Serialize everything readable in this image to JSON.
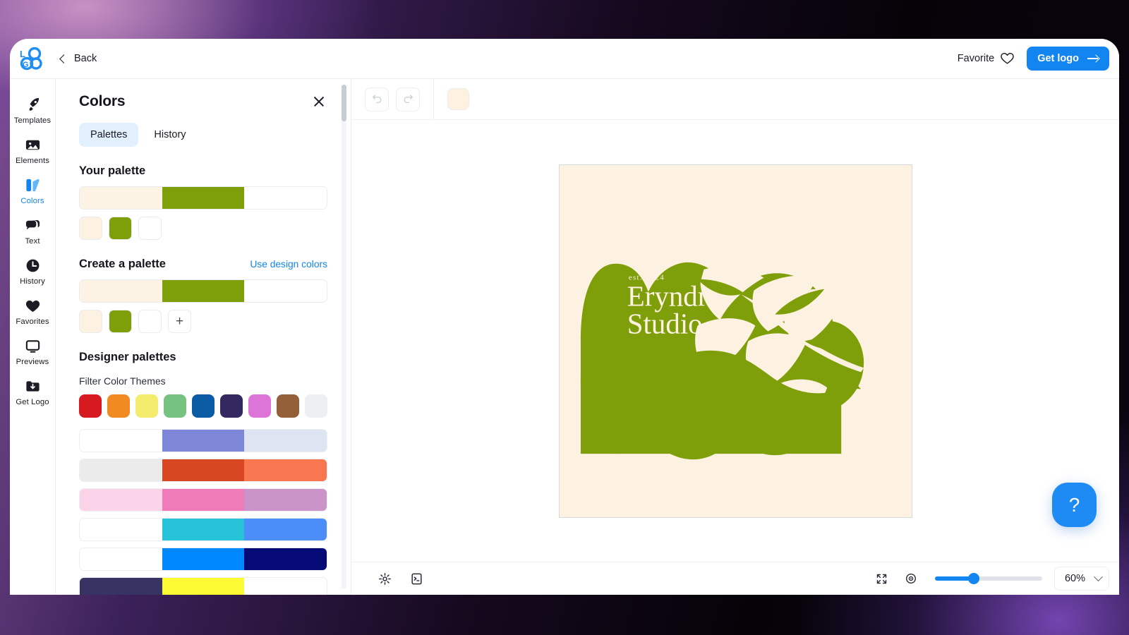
{
  "app": {
    "brand_name": "LOGO",
    "back_label": "Back",
    "favorite_label": "Favorite",
    "get_logo_label": "Get logo"
  },
  "rail": {
    "items": [
      {
        "label": "Templates",
        "icon": "rocket-icon",
        "active": false
      },
      {
        "label": "Elements",
        "icon": "image-icon",
        "active": false
      },
      {
        "label": "Colors",
        "icon": "palette-icon",
        "active": true
      },
      {
        "label": "Text",
        "icon": "speech-bubble-icon",
        "active": false
      },
      {
        "label": "History",
        "icon": "clock-icon",
        "active": false
      },
      {
        "label": "Favorites",
        "icon": "heart-icon",
        "active": false
      },
      {
        "label": "Previews",
        "icon": "monitor-icon",
        "active": false
      },
      {
        "label": "Get Logo",
        "icon": "download-folder-icon",
        "active": false
      }
    ]
  },
  "panel": {
    "title": "Colors",
    "close_icon": "close-icon",
    "tabs": [
      {
        "label": "Palettes",
        "selected": true
      },
      {
        "label": "History",
        "selected": false
      }
    ],
    "your_palette": {
      "heading": "Your palette",
      "bar_colors": [
        "#fdf3e4",
        "#7f9f0a",
        "#ffffff"
      ],
      "chips": [
        "#fdf1e2",
        "#7f9f0a",
        "#ffffff"
      ]
    },
    "create_palette": {
      "heading": "Create a palette",
      "link_label": "Use design colors",
      "bar_colors": [
        "#fdf3e4",
        "#7f9f0a",
        "#ffffff"
      ],
      "chips": [
        "#fdf1e2",
        "#7f9f0a",
        "#ffffff"
      ],
      "add_label": "+"
    },
    "designer_palettes": {
      "heading": "Designer palettes",
      "filter_label": "Filter Color Themes",
      "theme_swatches": [
        "#d71920",
        "#f08a21",
        "#f4ec6d",
        "#76c280",
        "#0b5ba4",
        "#33285f",
        "#dd75d9",
        "#93603a",
        "#eeeff0"
      ],
      "palettes": [
        [
          "#ffffff",
          "#7e86d8",
          "#dde5f2"
        ],
        [
          "#ebebeb",
          "#d64722",
          "#f97750"
        ],
        [
          "#fcd4e9",
          "#f07bb9",
          "#ca94c8"
        ],
        [
          "#ffffff",
          "#26c3d8",
          "#4c8ef8"
        ],
        [
          "#ffffff",
          "#0089ff",
          "#050a77"
        ],
        [
          "#373464",
          "#fcfb33",
          "#ffffff"
        ]
      ]
    }
  },
  "editor": {
    "undo_icon": "undo-icon",
    "redo_icon": "redo-icon",
    "background_swatch": "#fdf1e2",
    "settings_icon": "gear-icon",
    "console_icon": "terminal-icon",
    "fit_icon": "fit-to-screen-icon",
    "preview_icon": "eye-icon",
    "zoom_value": "60%",
    "zoom_slider_percent": 36,
    "help_label": "?"
  },
  "artboard": {
    "background": "#fdf1e2",
    "logo_color": "#7f9f0a",
    "tagline": "est. 2024",
    "name_line1": "Eryndra",
    "name_line2": "Studio"
  },
  "colors": {
    "accent": "#1385f1",
    "tab_selected_bg": "#e2f0fd",
    "text": "#1b1c25"
  }
}
